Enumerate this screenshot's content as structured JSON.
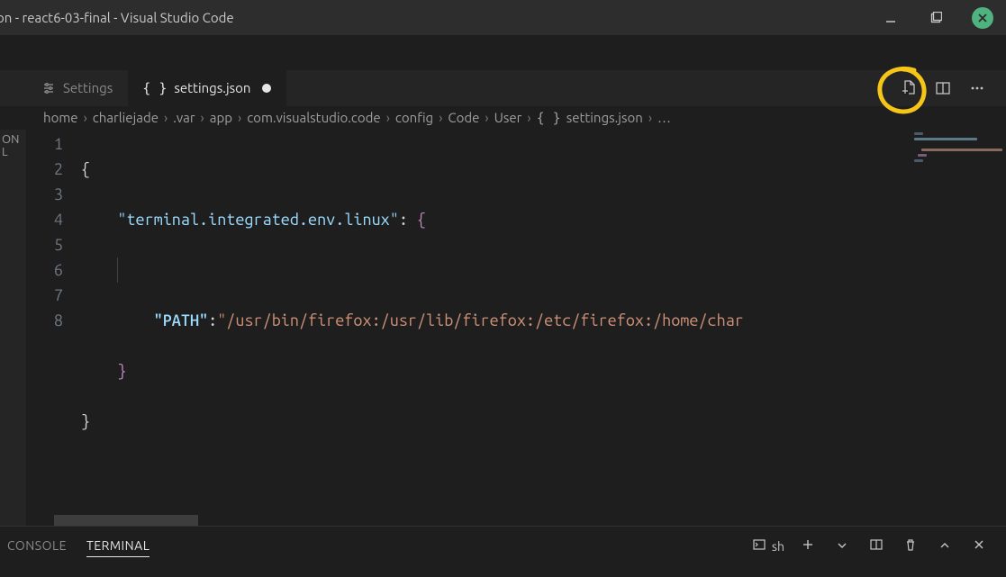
{
  "window": {
    "title": "on - react6-03-final - Visual Studio Code"
  },
  "tabs": [
    {
      "label": "Settings",
      "kind": "settings"
    },
    {
      "label": "settings.json",
      "kind": "json",
      "active": true,
      "dirty": true
    }
  ],
  "breadcrumbs": {
    "items": [
      "home",
      "charliejade",
      ".var",
      "app",
      "com.visualstudio.code",
      "config",
      "Code",
      "User"
    ],
    "file": "settings.json",
    "trailing": "…"
  },
  "editor": {
    "line_numbers": [
      "1",
      "2",
      "3",
      "4",
      "5",
      "6",
      "7",
      "8"
    ],
    "code": {
      "l1_brace": "{",
      "l2_key": "\"terminal.integrated.env.linux\"",
      "l2_colon": ": ",
      "l2_brace": "{",
      "l4_key": "\"PATH\"",
      "l4_colon": ":",
      "l4_val": "\"/usr/bin/firefox:/usr/lib/firefox:/etc/firefox:/home/char",
      "l5_brace": "}",
      "l6_brace": "}"
    }
  },
  "panel": {
    "tabs": {
      "console": "CONSOLE",
      "terminal": "TERMINAL"
    },
    "shell": "sh"
  },
  "left_stub": "ON L",
  "icons": {
    "settings": "settings-list-icon",
    "json": "braces-icon",
    "new_file": "new-file-icon",
    "split": "split-editor-icon",
    "more": "more-icon",
    "shell_box": "terminal-box-icon",
    "plus": "plus-icon",
    "chev_down": "chevron-down-icon",
    "panel_split": "split-panel-icon",
    "trash": "trash-icon",
    "chev_up": "chevron-up-icon",
    "close_x": "close-icon"
  }
}
